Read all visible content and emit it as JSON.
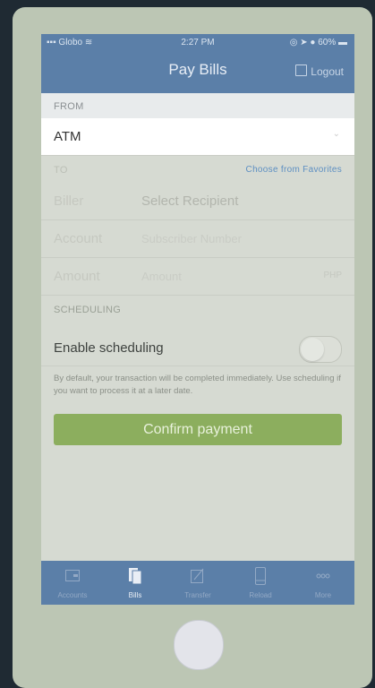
{
  "status_bar": {
    "carrier": "Globo",
    "time": "2:27 PM",
    "battery": "60%"
  },
  "nav": {
    "title": "Pay Bills",
    "logout_label": "Logout"
  },
  "from": {
    "header": "FROM",
    "value": "ATM"
  },
  "to": {
    "header": "TO",
    "favorites_link": "Choose from Favorites",
    "biller_label": "Biller",
    "biller_value": "Select Recipient",
    "account_label": "Account",
    "account_placeholder": "Subscriber Number",
    "amount_label": "Amount",
    "amount_placeholder": "Amount",
    "currency": "PHP"
  },
  "scheduling": {
    "header": "SCHEDULING",
    "toggle_label": "Enable scheduling",
    "enabled": false,
    "note": "By default, your transaction will be completed immediately. Use scheduling if you want to process it at a later date."
  },
  "confirm_label": "Confirm payment",
  "tabs": [
    {
      "label": "Accounts",
      "icon": "wallet-icon"
    },
    {
      "label": "Bills",
      "icon": "bills-icon"
    },
    {
      "label": "Transfer",
      "icon": "transfer-icon"
    },
    {
      "label": "Reload",
      "icon": "phone-icon"
    },
    {
      "label": "More",
      "icon": "more-icon"
    }
  ],
  "colors": {
    "header": "#5b7fa8",
    "confirm": "#8cae5e",
    "link": "#5d8fc2"
  }
}
